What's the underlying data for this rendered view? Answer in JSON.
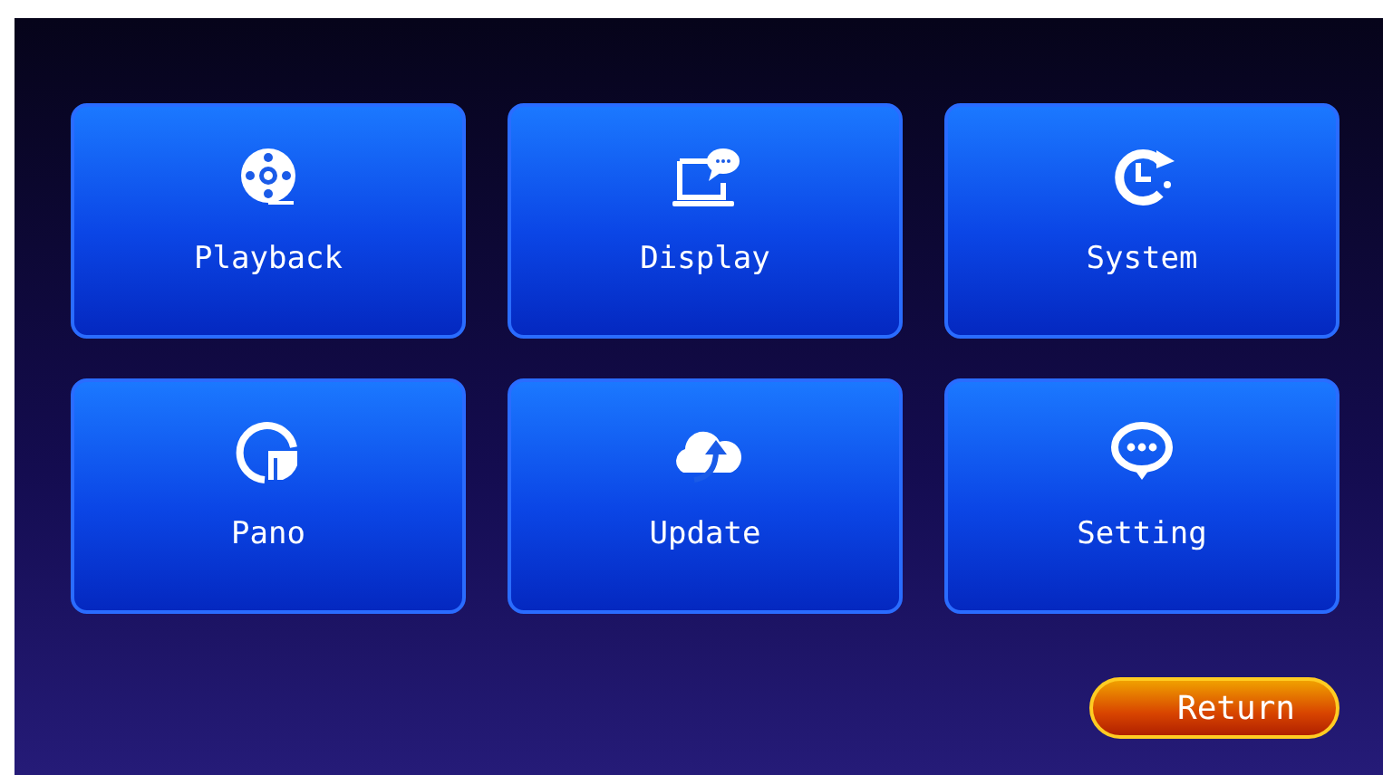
{
  "tiles": [
    {
      "label": "Playback"
    },
    {
      "label": "Display"
    },
    {
      "label": "System"
    },
    {
      "label": "Pano"
    },
    {
      "label": "Update"
    },
    {
      "label": "Setting"
    }
  ],
  "return_button": "Return"
}
